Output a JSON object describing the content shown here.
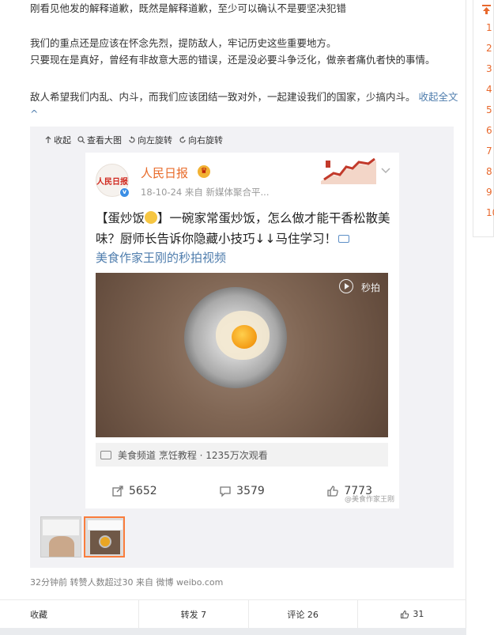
{
  "post": {
    "paragraphs": [
      "刚看见他发的解释道歉，既然是解释道歉，至少可以确认不是要坚决犯错",
      "我们的重点还是应该在怀念先烈，提防敌人，牢记历史这些重要地方。",
      "只要现在是真好，曾经有非故意大恶的错误，还是没必要斗争泛化，做亲者痛仇者快的事情。",
      "敌人希望我们内乱、内斗，而我们应该团结一致对外，一起建设我们的国家，少搞内斗。"
    ],
    "collapse_label": "收起全文^"
  },
  "media_toolbar": {
    "collapse": "收起",
    "view_large": "查看大图",
    "rotate_left": "向左旋转",
    "rotate_right": "向右旋转"
  },
  "embedded_card": {
    "logo_text": "人民日报",
    "account_name": "人民日报",
    "meta": "18-10-24  来自 新媒体聚合平...",
    "text_part1": "【蛋炒饭",
    "text_part2": "】一碗家常蛋炒饭，怎么做才能干香松散美味？厨师长告诉你隐藏小技巧↓↓马住学习！",
    "video_link": "美食作家王刚的秒拍视频",
    "video_watermark": "秒拍",
    "video_info": "美食频道 烹饪教程 · 1235万次观看",
    "reposts": "5652",
    "comments": "3579",
    "likes": "7773",
    "weibo_watermark": "@美食作家王刚"
  },
  "footer": {
    "meta": "32分钟前 转赞人数超过30  来自 微博 weibo.com"
  },
  "actions": {
    "collect": "收藏",
    "repost": "转发 7",
    "comment": "评论 26",
    "like": "31"
  },
  "sidebar": {
    "items": [
      "1",
      "2",
      "3",
      "4",
      "5",
      "6",
      "7",
      "8",
      "9",
      "10"
    ]
  },
  "colors": {
    "link": "#4f7dad",
    "accent": "#eb7350",
    "account_name": "#e86b2a"
  }
}
